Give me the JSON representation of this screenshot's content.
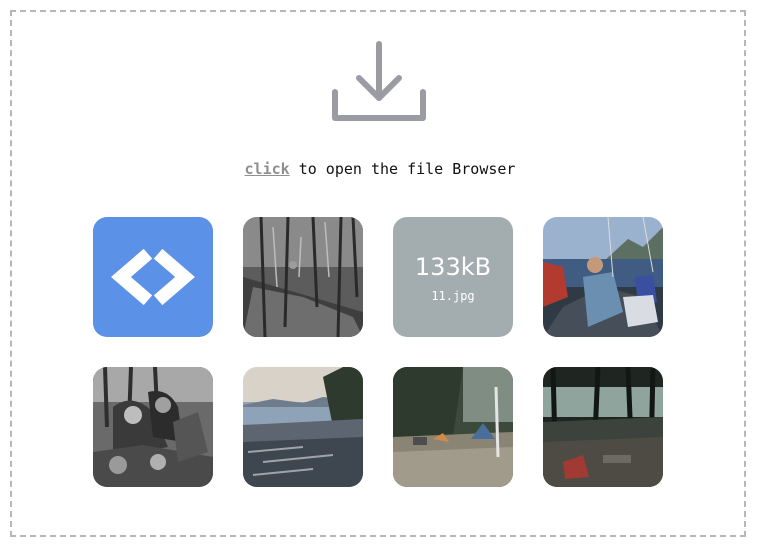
{
  "prompt": {
    "link_text": "click",
    "rest_text": " to open the file Browser"
  },
  "icons": {
    "upload": "download-tray-icon",
    "code": "code-brackets-icon"
  },
  "colors": {
    "code_tile": "#5b91e6",
    "size_tile": "#a3adb0",
    "icon_gray": "#9a9ba3",
    "link_gray": "#8f8f8f"
  },
  "files": [
    {
      "kind": "code-icon"
    },
    {
      "kind": "photo",
      "subject": "forest hillside black and white"
    },
    {
      "kind": "size-placeholder",
      "size": "133kB",
      "name": "11.jpg"
    },
    {
      "kind": "photo",
      "subject": "sailboat passengers on lake"
    },
    {
      "kind": "photo",
      "subject": "group with backpacks black and white"
    },
    {
      "kind": "photo",
      "subject": "lake shore with beached logs"
    },
    {
      "kind": "photo",
      "subject": "campsite with tent"
    },
    {
      "kind": "photo",
      "subject": "camp by lake in forest"
    }
  ]
}
